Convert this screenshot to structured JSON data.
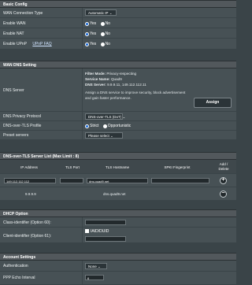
{
  "basic_config": {
    "header": "Basic Config",
    "wan_connection_type": {
      "label": "WAN Connection Type",
      "value": "Automatic IP"
    },
    "enable_wan": {
      "label": "Enable WAN",
      "options": [
        "Yes",
        "No"
      ],
      "selected": "Yes"
    },
    "enable_nat": {
      "label": "Enable NAT",
      "options": [
        "Yes",
        "No"
      ],
      "selected": "Yes"
    },
    "enable_upnp": {
      "label": "Enable UPnP",
      "link": "UPnP FAQ",
      "options": [
        "Yes",
        "No"
      ],
      "selected": "Yes"
    }
  },
  "wan_dns": {
    "header": "WAN DNS Setting",
    "dns_server": {
      "label": "DNS Server",
      "filter_mode_label": "Filter Mode:",
      "filter_mode_value": "Privacy-respecting",
      "service_name_label": "Service Name:",
      "service_name_value": "Quad9",
      "dns_server_label": "DNS Server:",
      "dns_server_value": "9.9.9.11, 149.112.112.11",
      "description": "Assign a DNS service to improve security, block advertisement and gain faster performance.",
      "assign_button": "Assign"
    },
    "dns_privacy_protocol": {
      "label": "DNS Privacy Protocol",
      "value": "DNS-over-TLS (DoT)"
    },
    "dot_profile": {
      "label": "DNS-over-TLS Profile",
      "options": [
        "Strict",
        "Opportunistic"
      ],
      "selected": "Strict"
    },
    "preset_servers": {
      "label": "Preset servers",
      "value": "Please select"
    }
  },
  "dot_list": {
    "header": "DNS-over-TLS Server List (Max Limit : 8)",
    "columns": [
      "IP Address",
      "TLS Port",
      "TLS Hostname",
      "SPKI Fingerprint",
      "Add / Delete"
    ],
    "rows": [
      {
        "ip": "149.112.112.112",
        "port": "",
        "hostname": "dns.quad9.net",
        "spki": "",
        "action": "+"
      },
      {
        "ip": "9.9.9.9",
        "port": "",
        "hostname": "dns.quad9.net",
        "spki": "",
        "action": "−"
      }
    ]
  },
  "dhcp": {
    "header": "DHCP Option",
    "class_id": {
      "label": "Class-identifier (Option 60):",
      "value": ""
    },
    "client_id": {
      "label": "Client-identifier (Option 61):",
      "checkbox_label": "IAID/DUID",
      "value": ""
    }
  },
  "account": {
    "header": "Account Settings",
    "authentication": {
      "label": "Authentication",
      "value": "None"
    },
    "ppp_echo": {
      "label": "PPP Echo Interval",
      "value": "6"
    }
  }
}
